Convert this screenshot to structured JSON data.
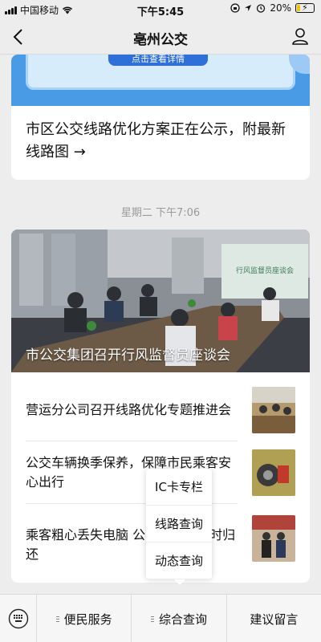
{
  "status_bar": {
    "carrier": "中国移动",
    "time": "下午5:45",
    "battery": "20%",
    "battery_level": 0.2,
    "icons": [
      "signal-icon",
      "wifi-icon",
      "screen-lock-icon",
      "location-icon",
      "alarm-icon",
      "battery-icon"
    ]
  },
  "nav": {
    "title": "亳州公交",
    "back_icon": "chevron-left-icon",
    "profile_icon": "user-icon"
  },
  "feed": {
    "top_card": {
      "banner_button_label": "点击查看详情",
      "article_title": "市区公交线路优化方案正在公示，附最新线路图 →"
    },
    "timestamp": "星期二 下午7:06",
    "news_card": {
      "hero_caption": "市公交集团召开行风监督员座谈会",
      "hero_screen_text": "行风监督员座谈会",
      "items": [
        {
          "title": "营运分公司召开线路优化专题推进会"
        },
        {
          "title": "公交车辆换季保养，保障市民乘客安心出行"
        },
        {
          "title": "乘客粗心丢失电脑 公交驾驶员及时归还"
        }
      ]
    }
  },
  "popup_menu": {
    "items": [
      "IC卡专栏",
      "线路查询",
      "动态查询"
    ]
  },
  "bottom_menu": {
    "keyboard_icon": "keyboard-icon",
    "buttons": [
      "便民服务",
      "综合查询",
      "建议留言"
    ]
  },
  "colors": {
    "background": "#ededed",
    "banner_blue": "#4a9be6",
    "banner_button": "#2f6fd8",
    "battery_fill": "#f2c200"
  }
}
